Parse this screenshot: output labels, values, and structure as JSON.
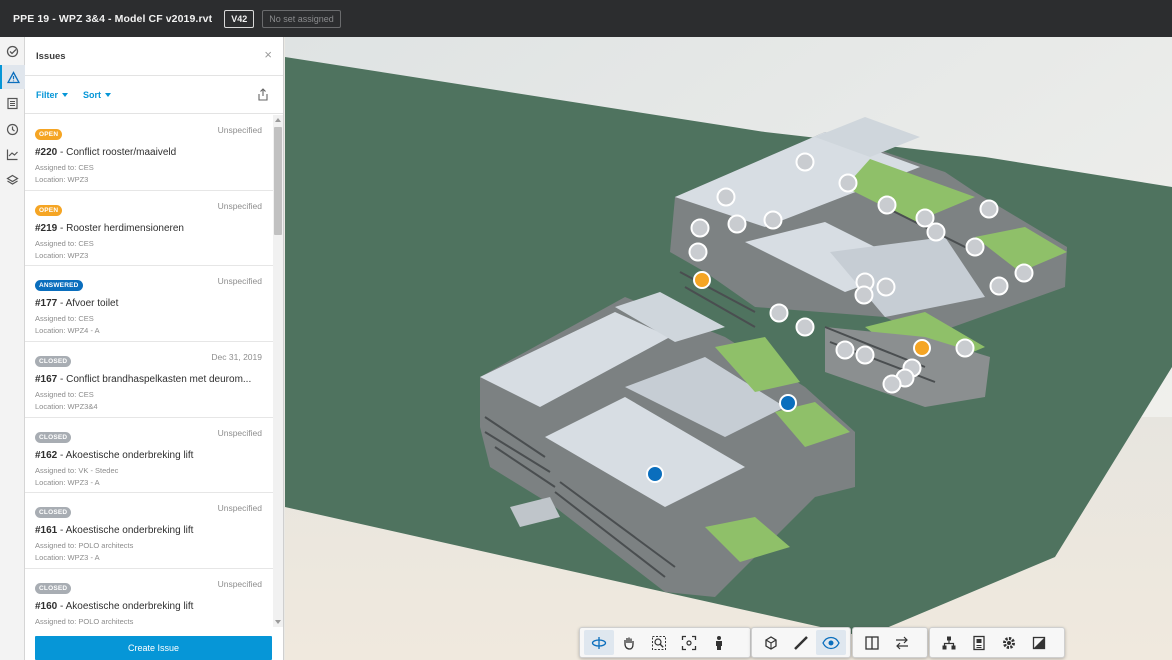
{
  "header": {
    "title": "PPE 19 - WPZ 3&4 - Model CF v2019.rvt",
    "version": "V42",
    "set_status": "No set assigned"
  },
  "rail": {
    "icons": [
      "checklist-icon",
      "warning-icon",
      "document-icon",
      "clock-icon",
      "chart-icon",
      "layers-icon"
    ],
    "active": "warning-icon"
  },
  "panel": {
    "title": "Issues",
    "filter_label": "Filter",
    "sort_label": "Sort",
    "create_label": "Create Issue",
    "issues": [
      {
        "status": "OPEN",
        "due": "Unspecified",
        "number": "#220",
        "title": "Conflict rooster/maaiveld",
        "assigned": "Assigned to: CES",
        "location": "Location: WPZ3"
      },
      {
        "status": "OPEN",
        "due": "Unspecified",
        "number": "#219",
        "title": "Rooster herdimensioneren",
        "assigned": "Assigned to: CES",
        "location": "Location: WPZ3"
      },
      {
        "status": "ANSWERED",
        "due": "Unspecified",
        "number": "#177",
        "title": "Afvoer toilet",
        "assigned": "Assigned to: CES",
        "location": "Location: WPZ4 - A"
      },
      {
        "status": "CLOSED",
        "due": "Dec 31, 2019",
        "number": "#167",
        "title": "Conflict brandhaspelkasten met deurom...",
        "assigned": "Assigned to: CES",
        "location": "Location: WPZ3&4"
      },
      {
        "status": "CLOSED",
        "due": "Unspecified",
        "number": "#162",
        "title": "Akoestische onderbreking lift",
        "assigned": "Assigned to: VK - Stedec",
        "location": "Location: WPZ3 - A"
      },
      {
        "status": "CLOSED",
        "due": "Unspecified",
        "number": "#161",
        "title": "Akoestische onderbreking lift",
        "assigned": "Assigned to: POLO architects",
        "location": "Location: WPZ3 - A"
      },
      {
        "status": "CLOSED",
        "due": "Unspecified",
        "number": "#160",
        "title": "Akoestische onderbreking lift",
        "assigned": "Assigned to: POLO architects",
        "location": ""
      }
    ]
  },
  "viewer": {
    "pin_colors": {
      "open": "#f5a524",
      "answered": "#0a6ebd",
      "closed": "#c9ccd0"
    },
    "toolbar_groups": [
      [
        "orbit-icon",
        "pan-icon",
        "zoom-window-icon",
        "fit-view-icon",
        "first-person-icon"
      ],
      [
        "camera-icon",
        "measure-icon",
        "issues-visibility-icon"
      ],
      [
        "section-icon",
        "explode-icon"
      ],
      [
        "model-browser-icon",
        "properties-icon",
        "settings-icon",
        "fullscreen-icon"
      ]
    ]
  }
}
